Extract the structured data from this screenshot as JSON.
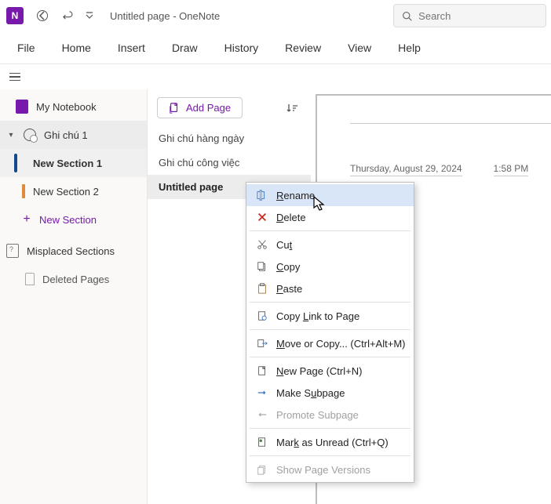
{
  "titlebar": {
    "app_initial": "N",
    "back_label": "Back",
    "undo_label": "Undo",
    "customize_label": "Customize Quick Access Toolbar",
    "title": "Untitled page  -  OneNote"
  },
  "search": {
    "placeholder": "Search"
  },
  "ribbon": {
    "tabs": [
      "File",
      "Home",
      "Insert",
      "Draw",
      "History",
      "Review",
      "View",
      "Help"
    ]
  },
  "sidebar": {
    "notebook": "My Notebook",
    "ghichu": "Ghi chú 1",
    "sections": [
      {
        "label": "New Section 1",
        "color": "blue",
        "selected": true
      },
      {
        "label": "New Section 2",
        "color": "orange",
        "selected": false
      }
    ],
    "new_section": "New Section",
    "misplaced": "Misplaced Sections",
    "deleted": "Deleted Pages"
  },
  "pages": {
    "add_label": "Add Page",
    "items": [
      {
        "label": "Ghi chú hàng ngày",
        "selected": false
      },
      {
        "label": "Ghi chú công việc",
        "selected": false
      },
      {
        "label": "Untitled page",
        "selected": true
      }
    ]
  },
  "canvas": {
    "date": "Thursday, August 29, 2024",
    "time": "1:58 PM"
  },
  "contextmenu": {
    "items": [
      {
        "icon": "rename",
        "pre": "",
        "mn": "R",
        "post": "ename",
        "shortcut": "",
        "disabled": false,
        "hover": true
      },
      {
        "icon": "delete",
        "pre": "",
        "mn": "D",
        "post": "elete",
        "shortcut": "",
        "disabled": false
      },
      {
        "sep": true
      },
      {
        "icon": "cut",
        "pre": "Cu",
        "mn": "t",
        "post": "",
        "shortcut": "",
        "disabled": false
      },
      {
        "icon": "copy",
        "pre": "",
        "mn": "C",
        "post": "opy",
        "shortcut": "",
        "disabled": false
      },
      {
        "icon": "paste",
        "pre": "",
        "mn": "P",
        "post": "aste",
        "shortcut": "",
        "disabled": false
      },
      {
        "sep": true
      },
      {
        "icon": "link",
        "pre": "Copy ",
        "mn": "L",
        "post": "ink to Page",
        "shortcut": "",
        "disabled": false
      },
      {
        "sep": true
      },
      {
        "icon": "move",
        "pre": "",
        "mn": "M",
        "post": "ove or Copy...  (Ctrl+Alt+M)",
        "shortcut": "",
        "disabled": false
      },
      {
        "sep": true
      },
      {
        "icon": "newpage",
        "pre": "",
        "mn": "N",
        "post": "ew Page  (Ctrl+N)",
        "shortcut": "",
        "disabled": false
      },
      {
        "icon": "subpage",
        "pre": "Make S",
        "mn": "u",
        "post": "bpage",
        "shortcut": "",
        "disabled": false
      },
      {
        "icon": "promote",
        "pre": "Promote Subpage",
        "mn": "",
        "post": "",
        "shortcut": "",
        "disabled": true
      },
      {
        "sep": true
      },
      {
        "icon": "unread",
        "pre": "Mar",
        "mn": "k",
        "post": " as Unread  (Ctrl+Q)",
        "shortcut": "",
        "disabled": false
      },
      {
        "sep": true
      },
      {
        "icon": "versions",
        "pre": "Show Page Versions",
        "mn": "",
        "post": "",
        "shortcut": "",
        "disabled": true
      }
    ]
  }
}
